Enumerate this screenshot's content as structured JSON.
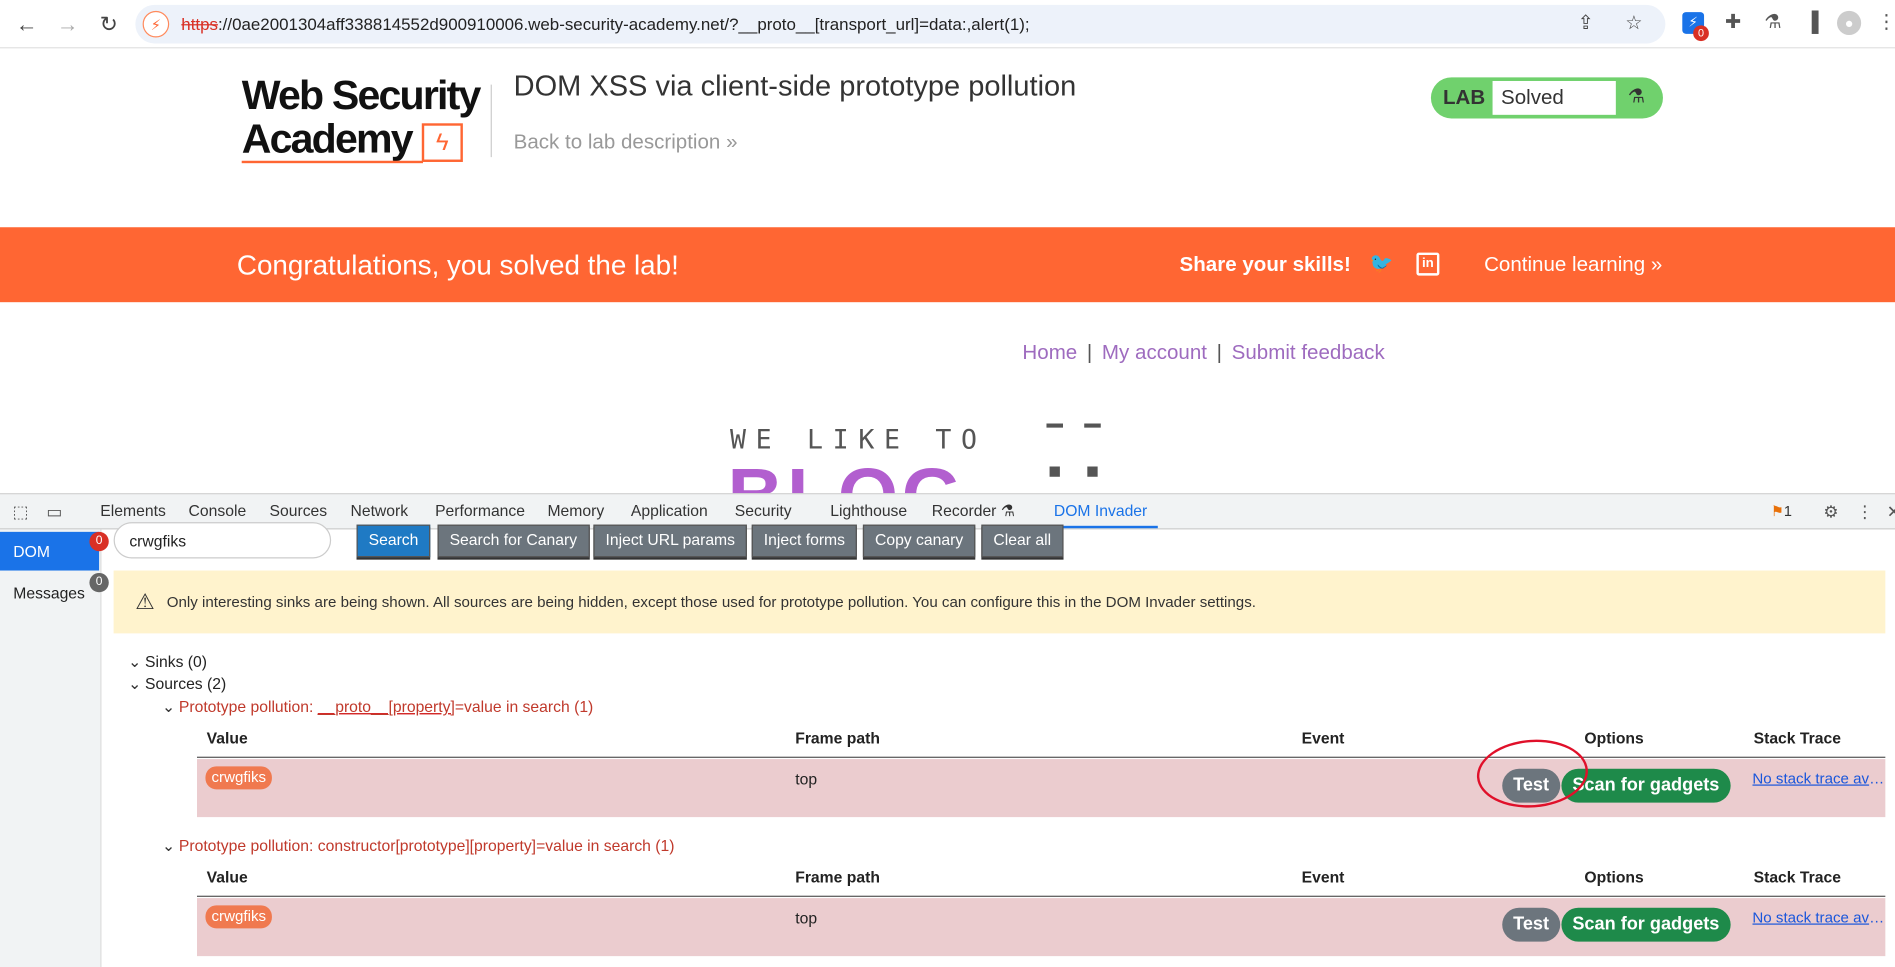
{
  "browser": {
    "url_scheme": "https",
    "url_rest": "://0ae2001304aff338814552d900910006.web-security-academy.net/?__proto__[transport_url]=data:,alert(1);",
    "ext_badge": "0"
  },
  "header": {
    "logo_line1": "Web Security",
    "logo_line2": "Academy",
    "title": "DOM XSS via client-side prototype pollution",
    "back_link": "Back to lab description",
    "lab_tag": "LAB",
    "lab_status": "Solved"
  },
  "banner": {
    "title": "Congratulations, you solved the lab!",
    "share": "Share your skills!",
    "continue": "Continue learning"
  },
  "site_nav": {
    "home": "Home",
    "account": "My account",
    "feedback": "Submit feedback"
  },
  "blog": {
    "subtitle": "WE LIKE TO",
    "big": "BLOG"
  },
  "devtools": {
    "tabs": [
      "Elements",
      "Console",
      "Sources",
      "Network",
      "Performance",
      "Memory",
      "Application",
      "Security",
      "Lighthouse",
      "Recorder",
      "DOM Invader"
    ],
    "issues_count": "1"
  },
  "invader": {
    "side_dom": "DOM",
    "side_dom_badge": "0",
    "side_messages": "Messages",
    "side_messages_badge": "0",
    "search_value": "crwgfiks",
    "buttons": [
      "Search",
      "Search for Canary",
      "Inject URL params",
      "Inject forms",
      "Copy canary",
      "Clear all"
    ],
    "warning": "Only interesting sinks are being shown. All sources are being hidden, except those used for prototype pollution. You can configure this in the DOM Invader settings.",
    "sinks_label": "Sinks (0)",
    "sources_label": "Sources (2)",
    "groups": [
      {
        "prefix": "Prototype pollution: ",
        "technique": "__proto__[property]",
        "suffix": "=value in search (1)",
        "row": {
          "value": "crwgfiks",
          "frame": "top",
          "event": "",
          "stack": "No stack trace available"
        }
      },
      {
        "prefix": "Prototype pollution: ",
        "technique": "constructor[prototype][property]",
        "suffix": "=value in search (1)",
        "row": {
          "value": "crwgfiks",
          "frame": "top",
          "event": "",
          "stack": "No stack trace available"
        }
      }
    ],
    "columns": {
      "value": "Value",
      "frame": "Frame path",
      "event": "Event",
      "options": "Options",
      "stack": "Stack Trace"
    },
    "test_label": "Test",
    "scan_label": "Scan for gadgets"
  }
}
